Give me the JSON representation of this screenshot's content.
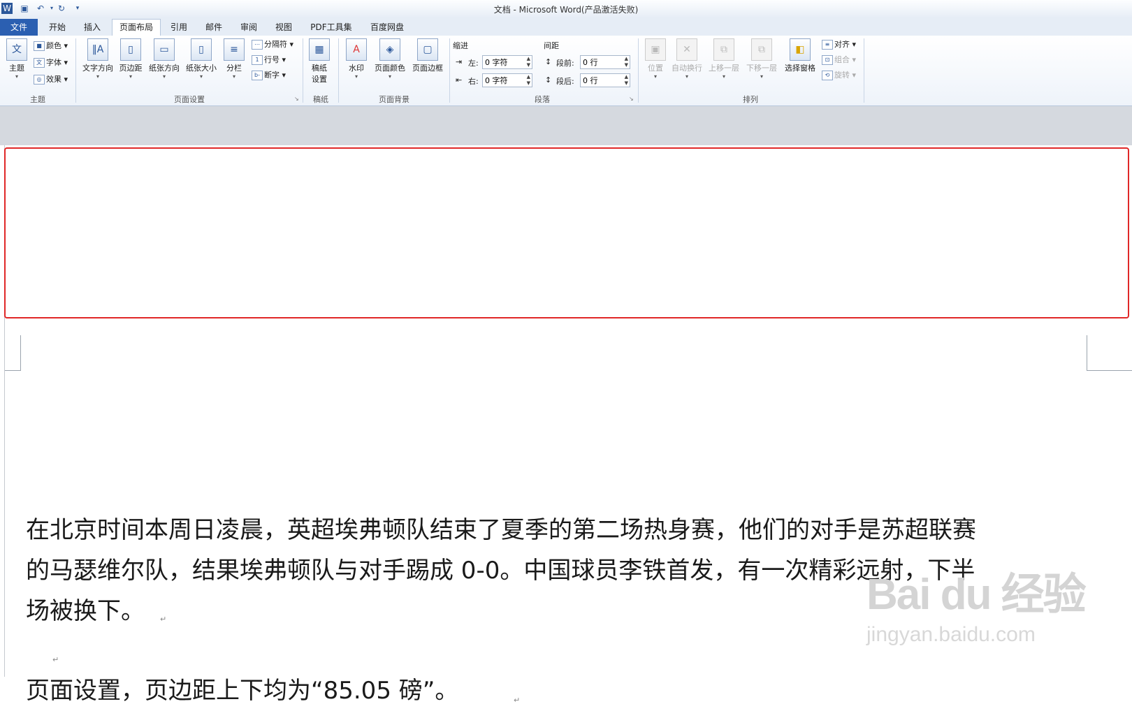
{
  "window": {
    "title": "文档 - Microsoft Word(产品激活失败)"
  },
  "quick_access": {
    "app_icon": "word-icon",
    "save_icon": "save-icon",
    "undo_icon": "undo-icon",
    "redo_icon": "redo-icon"
  },
  "tabs": [
    "文件",
    "开始",
    "插入",
    "页面布局",
    "引用",
    "邮件",
    "审阅",
    "视图",
    "PDF工具集",
    "百度网盘"
  ],
  "ribbon": {
    "theme": {
      "theme_label": "主题",
      "colors": "颜色",
      "fonts": "字体",
      "effects": "效果",
      "group": "主题"
    },
    "page_setup": {
      "text_direction": "文字方向",
      "margins": "页边距",
      "orientation": "纸张方向",
      "size": "纸张大小",
      "columns": "分栏",
      "breaks": "分隔符",
      "line_numbers": "行号",
      "hyphenation": "断字",
      "group": "页面设置"
    },
    "draft": {
      "draft_setup_1": "稿纸",
      "draft_setup_2": "设置",
      "group": "稿纸"
    },
    "background": {
      "watermark": "水印",
      "page_color": "页面颜色",
      "page_borders": "页面边框",
      "group": "页面背景"
    },
    "paragraph": {
      "indent": "缩进",
      "spacing": "间距",
      "left": "左:",
      "right": "右:",
      "before": "段前:",
      "after": "段后:",
      "left_val": "0 字符",
      "right_val": "0 字符",
      "before_val": "0 行",
      "after_val": "0 行",
      "group": "段落"
    },
    "arrange": {
      "position": "位置",
      "wrap": "自动换行",
      "forward": "上移一层",
      "backward": "下移一层",
      "selection_pane": "选择窗格",
      "align": "对齐",
      "group_obj": "组合",
      "rotate": "旋转",
      "group": "排列"
    }
  },
  "document": {
    "line1": "在北京时间本周日凌晨，英超埃弗顿队结束了夏季的第二场热身赛，他们的对手是苏超联赛",
    "line2": "的马瑟维尔队，结果埃弗顿队与对手踢成 0-0。中国球员李铁首发，有一次精彩远射，下半",
    "line3": "场被换下。",
    "line4": "页面设置，页边距上下均为“85.05 磅”。",
    "para_mark": "↵"
  },
  "watermark": {
    "brand": "Bai du 经验",
    "url": "jingyan.baidu.com"
  },
  "colors": {
    "file_tab": "#2b5fb1",
    "highlight_box": "#e02828"
  }
}
